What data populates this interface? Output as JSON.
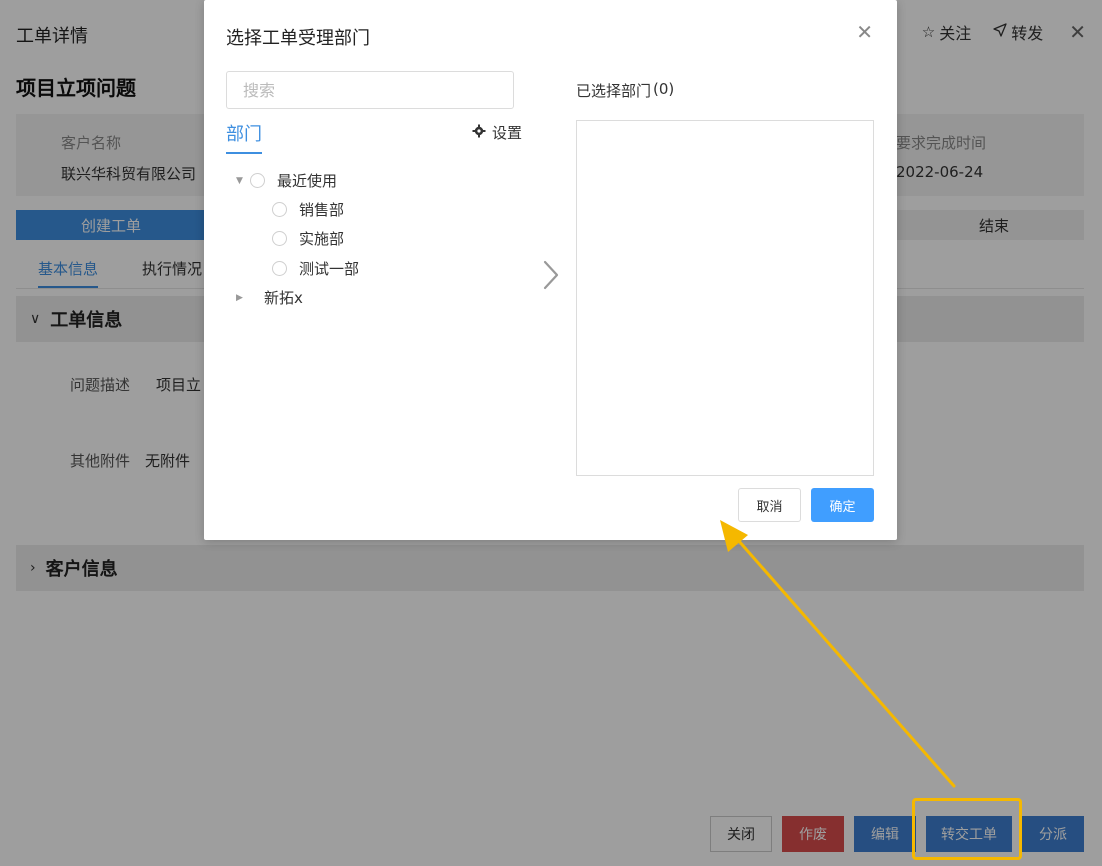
{
  "page": {
    "heading": "工单详情",
    "follow_label": "关注",
    "forward_label": "转发",
    "ticket_title": "项目立项问题",
    "summary": {
      "customer_label": "客户名称",
      "customer_value": "联兴华科贸有限公司",
      "due_label": "要求完成时间",
      "due_value": "2022-06-24"
    },
    "steps": {
      "first": "创建工单",
      "last": "结束"
    },
    "tabs": [
      "基本信息",
      "执行情况"
    ],
    "sections": {
      "ticket_info": "工单信息",
      "customer_info": "客户信息"
    },
    "fields": {
      "desc_label": "问题描述",
      "desc_value": "项目立",
      "attach_label": "其他附件",
      "attach_value": "无附件"
    },
    "footer": {
      "close": "关闭",
      "void": "作废",
      "edit": "编辑",
      "transfer": "转交工单",
      "assign": "分派"
    }
  },
  "modal": {
    "title": "选择工单受理部门",
    "search_placeholder": "搜索",
    "dept_tab": "部门",
    "settings_label": "设置",
    "tree": {
      "recent": "最近使用",
      "recent_children": [
        "销售部",
        "实施部",
        "测试一部"
      ],
      "other": "新拓x"
    },
    "selected_label": "已选择部门",
    "selected_count": "(0)",
    "cancel": "取消",
    "confirm": "确定"
  },
  "colors": {
    "primary": "#409eff",
    "step_active": "#3e8fe0",
    "danger": "#d94c4c",
    "annotation": "#f5b800"
  }
}
